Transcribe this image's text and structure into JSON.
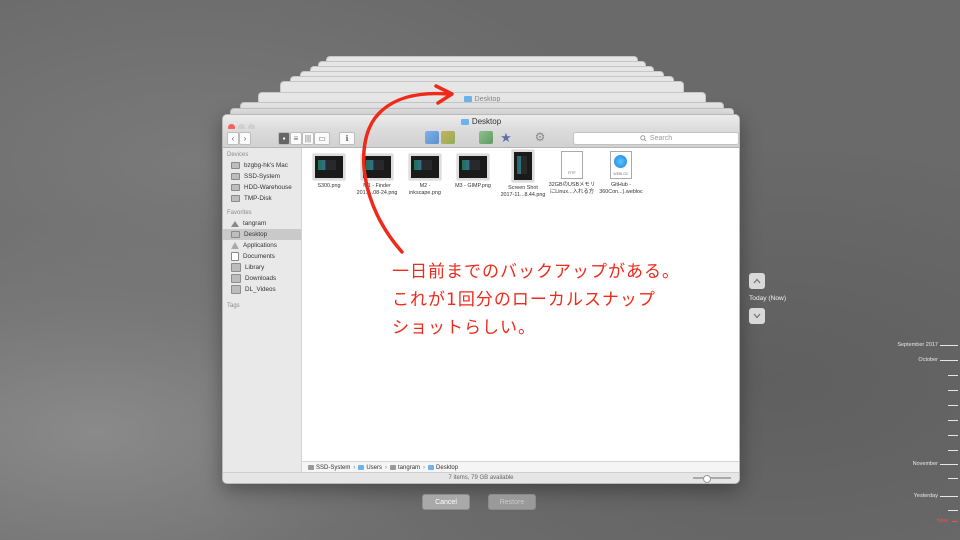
{
  "back_window": {
    "title": "Desktop"
  },
  "window": {
    "title": "Desktop",
    "search_placeholder": "Search",
    "sidebar": {
      "sections": [
        {
          "heading": "Devices",
          "items": [
            "bzgbg-hk's Mac",
            "SSD-System",
            "HDD-Warehouse",
            "TMP-Disk"
          ]
        },
        {
          "heading": "Favorites",
          "items": [
            "tangram",
            "Desktop",
            "Applications",
            "Documents",
            "Library",
            "Downloads",
            "DL_Videos"
          ]
        },
        {
          "heading": "Tags",
          "items": []
        }
      ],
      "selected": "Desktop"
    },
    "files": [
      {
        "name": "S300.png",
        "kind": "image"
      },
      {
        "name": "M1 - Finder\n2017...08-24.png",
        "kind": "image"
      },
      {
        "name": "M2 -\ninkscape.png",
        "kind": "image"
      },
      {
        "name": "M3 - GIMP.png",
        "kind": "image"
      },
      {
        "name": "Screen Shot\n2017-11...8.44.png",
        "kind": "image-tall"
      },
      {
        "name": "32GBのUSBメモリ\nにLinux...入れる方",
        "kind": "rtf",
        "badge": "RTF"
      },
      {
        "name": "GitHub -\n360Con...).webloc",
        "kind": "webloc",
        "badge": "WEBLOC"
      }
    ],
    "pathbar": [
      "SSD-System",
      "Users",
      "tangram",
      "Desktop"
    ],
    "status": "7 items, 79 GB available"
  },
  "buttons": {
    "cancel": "Cancel",
    "restore": "Restore"
  },
  "nav": {
    "today": "Today (Now)"
  },
  "timeline": [
    {
      "label": "September 2017"
    },
    {
      "label": "October"
    },
    {
      "label": "November"
    },
    {
      "label": "Yesterday"
    },
    {
      "label": "Now",
      "now": true
    }
  ],
  "annotation": {
    "lines": [
      "一日前までのバックアップがある。",
      "これが1回分のローカルスナップ",
      "ショットらしい。"
    ],
    "color": "#f02a1b"
  }
}
